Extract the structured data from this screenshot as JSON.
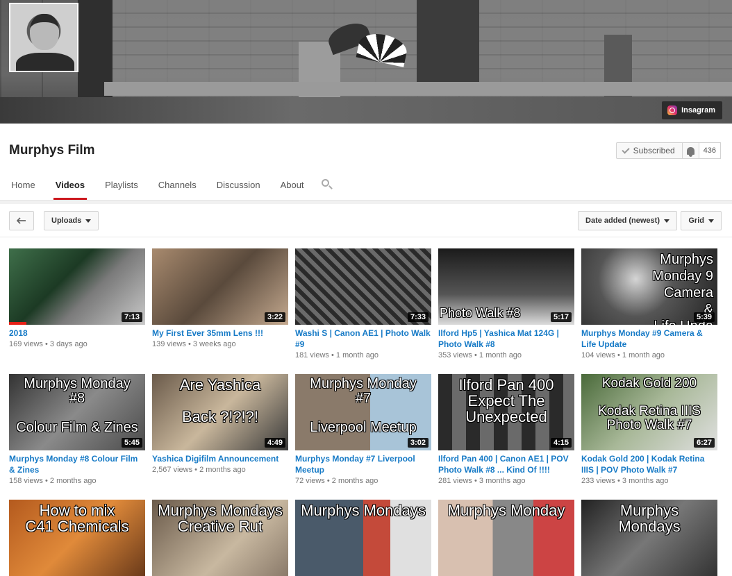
{
  "banner": {
    "social_link": "Insagram"
  },
  "channel": {
    "title": "Murphys Film",
    "subscribed_label": "Subscribed",
    "subscriber_count": "436"
  },
  "tabs": [
    {
      "label": "Home"
    },
    {
      "label": "Videos"
    },
    {
      "label": "Playlists"
    },
    {
      "label": "Channels"
    },
    {
      "label": "Discussion"
    },
    {
      "label": "About"
    }
  ],
  "toolbar": {
    "uploads_label": "Uploads",
    "sort_label": "Date added (newest)",
    "view_label": "Grid"
  },
  "videos": [
    {
      "title": "2018",
      "views": "169 views",
      "age": "3 days ago",
      "duration": "7:13",
      "thumb_text": ""
    },
    {
      "title": "My First Ever 35mm Lens !!!",
      "views": "139 views",
      "age": "3 weeks ago",
      "duration": "3:22",
      "thumb_text": ""
    },
    {
      "title": "Washi S | Canon AE1 | Photo Walk #9",
      "views": "181 views",
      "age": "1 month ago",
      "duration": "7:33",
      "thumb_text": ""
    },
    {
      "title": "Ilford Hp5 | Yashica Mat 124G | Photo Walk #8",
      "views": "353 views",
      "age": "1 month ago",
      "duration": "5:17",
      "thumb_text": "Photo Walk #8"
    },
    {
      "title": "Murphys Monday #9 Camera & Life Update",
      "views": "104 views",
      "age": "1 month ago",
      "duration": "5:39",
      "thumb_text": "Murphys\nMonday 9\nCamera\n&\nLife Upda"
    },
    {
      "title": "Murphys Monday #8 Colour Film & Zines",
      "views": "158 views",
      "age": "2 months ago",
      "duration": "5:45",
      "thumb_text": "Murphys Monday\n#8\n\nColour Film & Zines"
    },
    {
      "title": "Yashica Digifilm Announcement",
      "views": "2,567 views",
      "age": "2 months ago",
      "duration": "4:49",
      "thumb_text": "Are Yashica\n\nBack ?!?!?!"
    },
    {
      "title": "Murphys Monday #7 Liverpool Meetup",
      "views": "72 views",
      "age": "2 months ago",
      "duration": "3:02",
      "thumb_text": "Murphys Monday\n#7\n\nLiverpool Meetup"
    },
    {
      "title": "Ilford Pan 400 | Canon AE1 | POV Photo Walk #8 ... Kind Of !!!!",
      "views": "281 views",
      "age": "3 months ago",
      "duration": "4:15",
      "thumb_text": "Ilford Pan 400\nExpect The\nUnexpected"
    },
    {
      "title": "Kodak Gold 200 | Kodak Retina IIIS | POV Photo Walk #7",
      "views": "233 views",
      "age": "3 months ago",
      "duration": "6:27",
      "thumb_text": "Kodak Gold 200\n\nKodak Retina IIIS\nPhoto Walk #7"
    },
    {
      "title": "",
      "views": "",
      "age": "",
      "duration": "",
      "thumb_text": "How to mix\nC41 Chemicals"
    },
    {
      "title": "",
      "views": "",
      "age": "",
      "duration": "",
      "thumb_text": "Murphys Mondays\nCreative Rut"
    },
    {
      "title": "",
      "views": "",
      "age": "",
      "duration": "",
      "thumb_text": "Murphys Mondays"
    },
    {
      "title": "",
      "views": "",
      "age": "",
      "duration": "",
      "thumb_text": "Murphys Monday"
    },
    {
      "title": "",
      "views": "",
      "age": "",
      "duration": "",
      "thumb_text": "Murphys\nMondays"
    }
  ],
  "colors": {
    "accent_red": "#cc181e",
    "link_blue": "#167ac6"
  }
}
